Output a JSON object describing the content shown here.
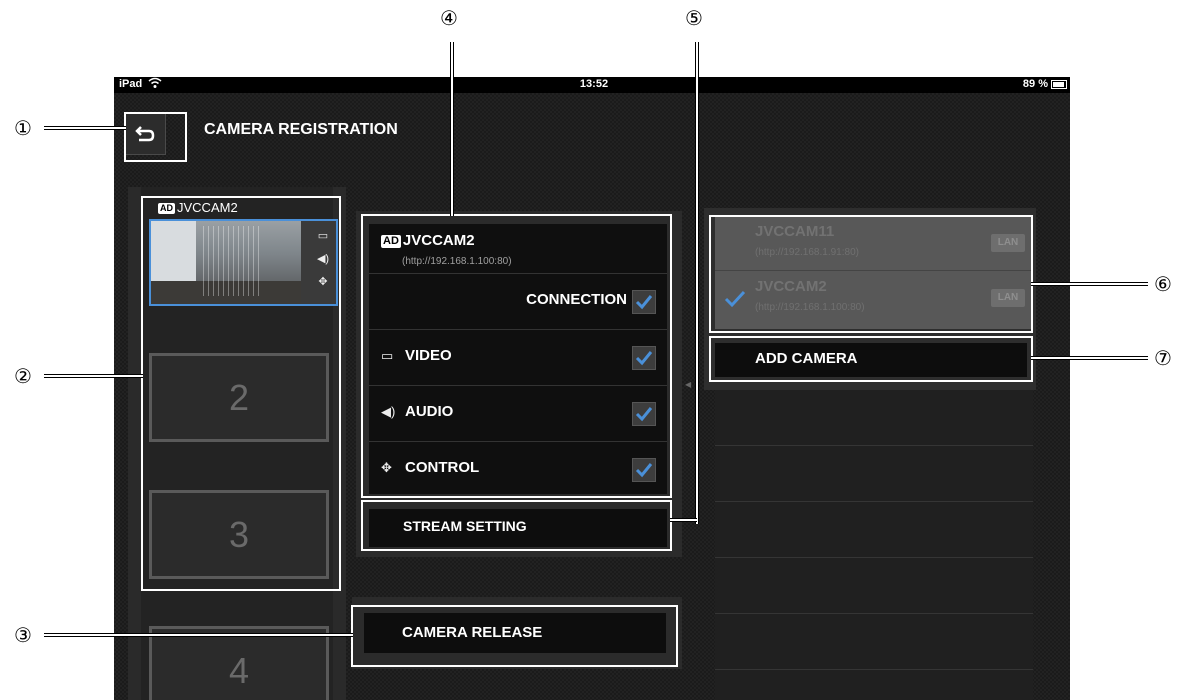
{
  "status_bar": {
    "device": "iPad",
    "time": "13:52",
    "battery": "89 %"
  },
  "header": {
    "title": "CAMERA REGISTRATION"
  },
  "left_column": {
    "active_camera": {
      "badge": "AD",
      "name": "JVCCAM2"
    },
    "thumb_icons": [
      "film-icon",
      "speaker-icon",
      "move-icon"
    ],
    "slots": [
      "2",
      "3",
      "4"
    ]
  },
  "detail": {
    "badge": "AD",
    "name": "JVCCAM2",
    "url": "(http://192.168.1.100:80)",
    "connection_label": "CONNECTION",
    "options": [
      {
        "icon": "film-icon",
        "label": "VIDEO",
        "checked": true
      },
      {
        "icon": "speaker-icon",
        "label": "AUDIO",
        "checked": true
      },
      {
        "icon": "move-icon",
        "label": "CONTROL",
        "checked": true
      }
    ],
    "stream_setting": "STREAM SETTING"
  },
  "release": {
    "label": "CAMERA RELEASE"
  },
  "camera_list": {
    "items": [
      {
        "name": "JVCCAM11",
        "url": "(http://192.168.1.91:80)",
        "type": "LAN",
        "selected": false
      },
      {
        "name": "JVCCAM2",
        "url": "(http://192.168.1.100:80)",
        "type": "LAN",
        "selected": true
      }
    ],
    "add_label": "ADD CAMERA"
  },
  "callouts": [
    "①",
    "②",
    "③",
    "④",
    "⑤",
    "⑥",
    "⑦"
  ],
  "colors": {
    "accent": "#4a90d9",
    "background": "#1b1b1b"
  }
}
